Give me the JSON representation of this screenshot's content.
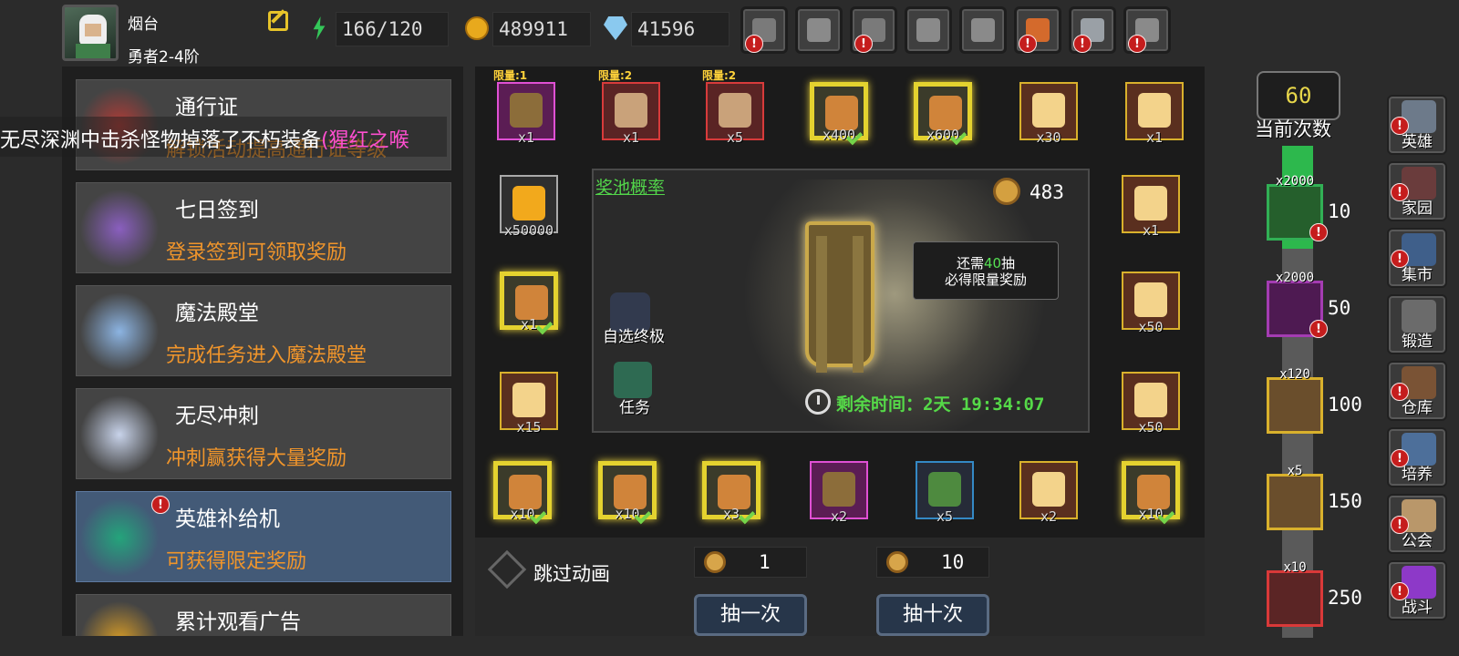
{
  "player": {
    "name": "烟台",
    "rank": "勇者2-4阶"
  },
  "resources": {
    "energy": "166/120",
    "gold": "489911",
    "gems": "41596"
  },
  "top_buttons": [
    {
      "name": "shop",
      "alert": true
    },
    {
      "name": "mail",
      "alert": false
    },
    {
      "name": "gamepad",
      "alert": true
    },
    {
      "name": "settings",
      "alert": false
    },
    {
      "name": "gift",
      "alert": false
    },
    {
      "name": "wheel",
      "alert": true
    },
    {
      "name": "fireworks",
      "alert": true
    },
    {
      "name": "battle",
      "alert": true
    }
  ],
  "alert_mark": "!",
  "menu": [
    {
      "title": "通行证",
      "desc": "解锁活动提高通行证等级",
      "active": false
    },
    {
      "title": "七日签到",
      "desc": "登录签到可领取奖励",
      "active": false
    },
    {
      "title": "魔法殿堂",
      "desc": "完成任务进入魔法殿堂",
      "active": false
    },
    {
      "title": "无尽冲刺",
      "desc": "冲刺赢获得大量奖励",
      "active": false
    },
    {
      "title": "英雄补给机",
      "desc": "可获得限定奖励",
      "active": true
    },
    {
      "title": "累计观看广告",
      "desc": "",
      "active": false
    }
  ],
  "marquee": {
    "text": "无尽深渊中击杀怪物掉落了不朽装备",
    "highlight": "(猩红之喉"
  },
  "gacha": {
    "top_row": [
      {
        "tag": "限量:1",
        "count": "x1",
        "style": "purple",
        "claimed": false
      },
      {
        "tag": "限量:2",
        "count": "x1",
        "style": "red",
        "claimed": false
      },
      {
        "tag": "限量:2",
        "count": "x5",
        "style": "red",
        "claimed": false
      },
      {
        "tag": "",
        "count": "x400",
        "style": "gold",
        "claimed": true
      },
      {
        "tag": "",
        "count": "x600",
        "style": "gold",
        "claimed": true
      },
      {
        "tag": "",
        "count": "x30",
        "style": "orange",
        "claimed": false
      },
      {
        "tag": "",
        "count": "x1",
        "style": "orange",
        "claimed": false
      }
    ],
    "left_col": [
      {
        "count": "x50000",
        "style": "green",
        "claimed": false
      },
      {
        "count": "x1",
        "style": "gold",
        "claimed": true
      },
      {
        "count": "x15",
        "style": "orange",
        "claimed": false
      }
    ],
    "right_col": [
      {
        "count": "x1",
        "style": "orange",
        "claimed": false
      },
      {
        "count": "x50",
        "style": "orange",
        "claimed": false
      },
      {
        "count": "x50",
        "style": "orange",
        "claimed": false
      }
    ],
    "bottom_row": [
      {
        "count": "x10",
        "style": "gold",
        "claimed": true
      },
      {
        "count": "x10",
        "style": "gold",
        "claimed": true
      },
      {
        "count": "x3",
        "style": "gold",
        "claimed": true
      },
      {
        "count": "x2",
        "style": "purple",
        "claimed": false
      },
      {
        "count": "x5",
        "style": "dark",
        "claimed": false
      },
      {
        "count": "x2",
        "style": "orange",
        "claimed": false
      },
      {
        "count": "x10",
        "style": "gold",
        "claimed": true
      }
    ],
    "pool_link": "奖池概率",
    "key_count": "483",
    "pity_line1_prefix": "还需",
    "pity_line1_num": "40",
    "pity_line1_suffix": "抽",
    "pity_line2": "必得限量奖励",
    "auto_label": "自选终极",
    "task_label": "任务",
    "timer_label": "剩余时间：",
    "timer_value": "2天 19:34:07"
  },
  "controls": {
    "skip_label": "跳过动画",
    "single_cost": "1",
    "ten_cost": "10",
    "single_label": "抽一次",
    "ten_label": "抽十次"
  },
  "progress": {
    "count": "60",
    "label": "当前次数",
    "fill_fraction": 0.21,
    "milestones": [
      {
        "value": "10",
        "count": "x2000",
        "style": "green"
      },
      {
        "value": "50",
        "count": "x2000",
        "style": "purple"
      },
      {
        "value": "100",
        "count": "x120",
        "style": "orange"
      },
      {
        "value": "150",
        "count": "x5",
        "style": "orange"
      },
      {
        "value": "250",
        "count": "x10",
        "style": "red"
      }
    ]
  },
  "nav": [
    {
      "label": "英雄",
      "color": "#6d7a8a"
    },
    {
      "label": "家园",
      "color": "#6a3c3c"
    },
    {
      "label": "集市",
      "color": "#3f5f8a"
    },
    {
      "label": "锻造",
      "color": "#6b6b6b"
    },
    {
      "label": "仓库",
      "color": "#7a5335"
    },
    {
      "label": "培养",
      "color": "#4d6f9a"
    },
    {
      "label": "公会",
      "color": "#b9976a"
    },
    {
      "label": "战斗",
      "color": "#8d39c8"
    }
  ]
}
